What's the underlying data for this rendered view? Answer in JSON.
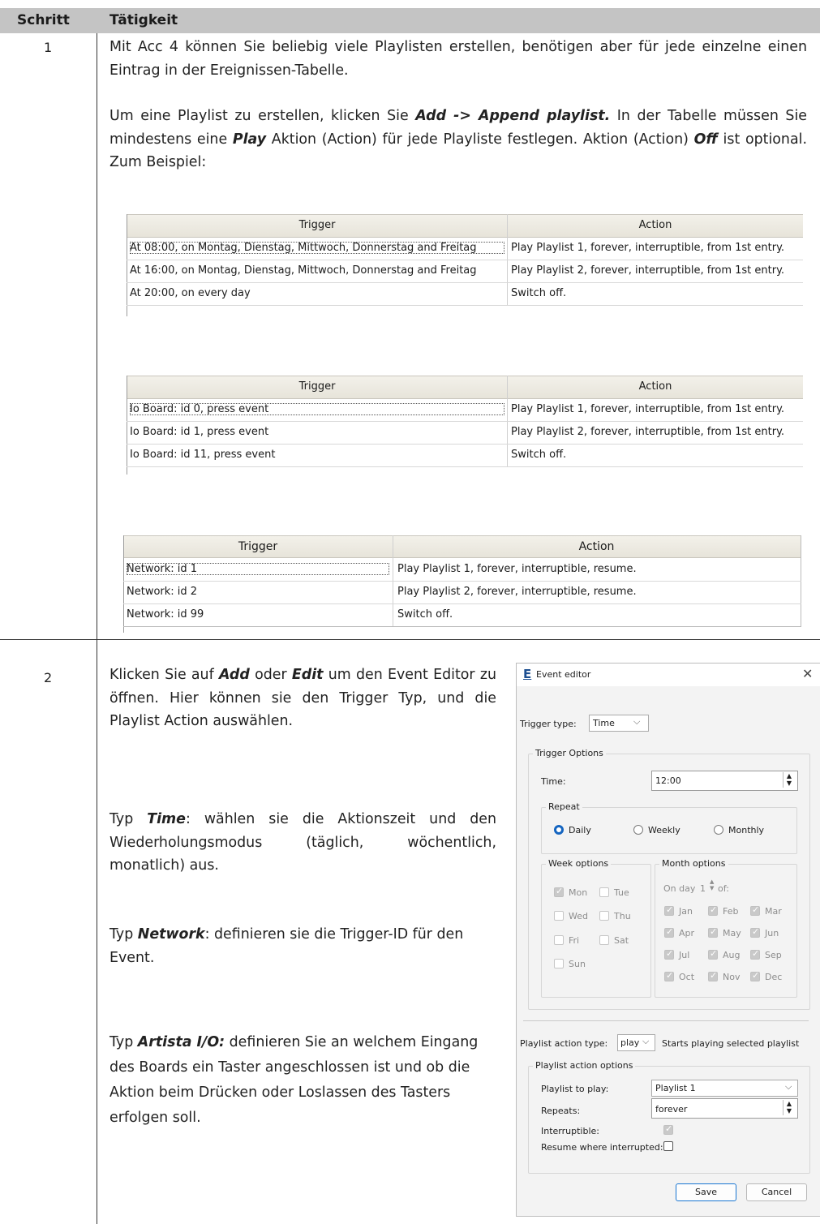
{
  "header": {
    "col1": "Schritt",
    "col2": "Tätigkeit"
  },
  "step1": {
    "number": "1",
    "p1": "Mit Acc 4 können Sie beliebig viele Playlisten erstellen, benötigen aber für jede einzelne einen Eintrag in der Ereignissen-Tabelle.",
    "p2_a": "Um eine Playlist zu erstellen, klicken Sie ",
    "p2_b": "Add -> Append playlist.",
    "p2_c": " In der Tabelle müssen Sie mindestens eine ",
    "p2_d": "Play",
    "p2_e": " Aktion (Action) für jede Playliste festlegen. Aktion (Action) ",
    "p2_f": "Off",
    "p2_g": " ist optional. Zum Beispiel:"
  },
  "tables": [
    {
      "headers": [
        "Trigger",
        "Action"
      ],
      "rows": [
        [
          "At 08:00, on Montag, Dienstag, Mittwoch, Donnerstag and Freitag",
          "Play Playlist 1, forever, interruptible, from 1st entry."
        ],
        [
          "At 16:00, on Montag, Dienstag, Mittwoch, Donnerstag and Freitag",
          "Play Playlist 2, forever, interruptible, from 1st entry."
        ],
        [
          "At 20:00, on every day",
          "Switch off."
        ]
      ]
    },
    {
      "headers": [
        "Trigger",
        "Action"
      ],
      "rows": [
        [
          "Io Board: id 0, press event",
          "Play Playlist 1, forever, interruptible, from 1st entry."
        ],
        [
          "Io Board: id 1, press event",
          "Play Playlist 2, forever, interruptible, from 1st entry."
        ],
        [
          "Io Board: id 11, press event",
          "Switch off."
        ]
      ]
    },
    {
      "headers": [
        "Trigger",
        "Action"
      ],
      "rows": [
        [
          "Network: id 1",
          "Play Playlist 1, forever, interruptible, resume."
        ],
        [
          "Network: id 2",
          "Play Playlist 2, forever, interruptible, resume."
        ],
        [
          "Network: id 99",
          "Switch off."
        ]
      ]
    }
  ],
  "step2": {
    "number": "2",
    "p1_a": "Klicken Sie auf ",
    "p1_b": "Add",
    "p1_c": " oder ",
    "p1_d": "Edit",
    "p1_e": " um den Event Editor zu öffnen. Hier können sie den Trigger Typ, und die Playlist Action auswählen.",
    "p2_a": "Typ ",
    "p2_b": "Time",
    "p2_c": ": wählen sie die Aktionszeit und den Wiederholungsmodus (täglich, wöchentlich, monatlich) aus.",
    "p3_a": "Typ ",
    "p3_b": "Network",
    "p3_c": ": definieren sie die Trigger-ID für den Event.",
    "p4_a": "Typ ",
    "p4_b": "Artista I/O:",
    "p4_c": " definieren Sie an welchem Eingang des Boards ein Taster angeschlossen ist und ob die Aktion beim Drücken oder Loslassen des Tasters erfolgen soll."
  },
  "editor": {
    "title": "Event editor",
    "trigger_type_label": "Trigger type:",
    "trigger_type_value": "Time",
    "trigger_options": "Trigger Options",
    "time_label": "Time:",
    "time_value": "12:00",
    "repeat": "Repeat",
    "daily": "Daily",
    "weekly": "Weekly",
    "monthly": "Monthly",
    "week_options": "Week options",
    "month_options": "Month options",
    "on_day": "On day",
    "on_day_value": "1",
    "of": "of:",
    "days": [
      {
        "label": "Mon",
        "checked": true
      },
      {
        "label": "Tue",
        "checked": false
      },
      {
        "label": "Wed",
        "checked": false
      },
      {
        "label": "Thu",
        "checked": false
      },
      {
        "label": "Fri",
        "checked": false
      },
      {
        "label": "Sat",
        "checked": false
      },
      {
        "label": "Sun",
        "checked": false
      }
    ],
    "months": [
      "Jan",
      "Feb",
      "Mar",
      "Apr",
      "May",
      "Jun",
      "Jul",
      "Aug",
      "Sep",
      "Oct",
      "Nov",
      "Dec"
    ],
    "playlist_action_type_label": "Playlist action type:",
    "playlist_action_type_value": "play",
    "playlist_action_desc": "Starts playing selected playlist",
    "playlist_action_options": "Playlist action options",
    "playlist_to_play_label": "Playlist to play:",
    "playlist_to_play_value": "Playlist 1",
    "repeats_label": "Repeats:",
    "repeats_value": "forever",
    "interruptible_label": "Interruptible:",
    "resume_label": "Resume where interrupted:",
    "save": "Save",
    "cancel": "Cancel"
  },
  "colors": {
    "accent": "#1565c0",
    "header_bg": "#c4c4c4"
  }
}
